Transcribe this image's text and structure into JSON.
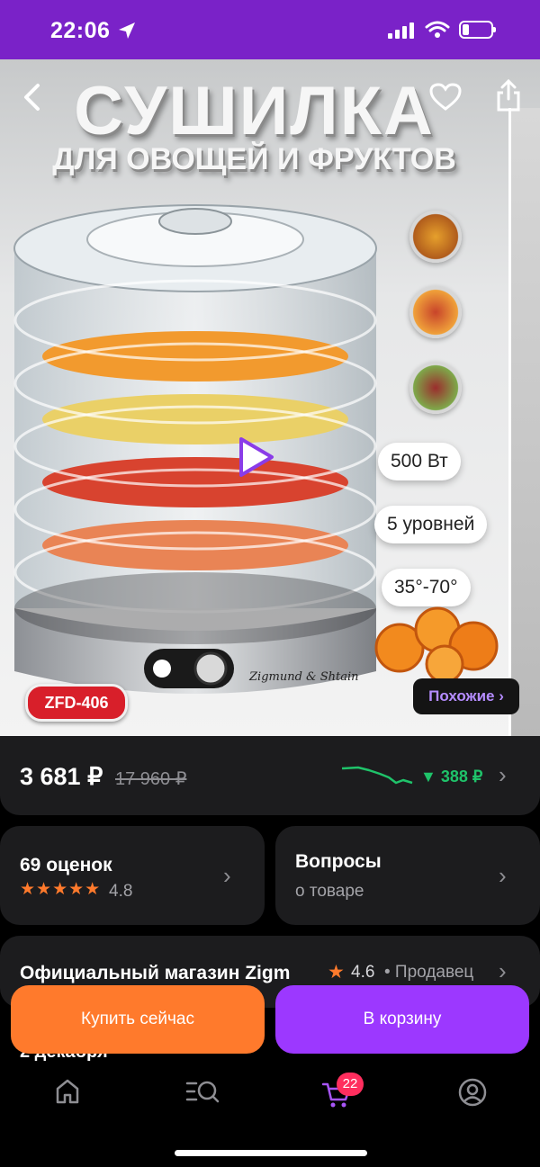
{
  "status_bar": {
    "time": "22:06"
  },
  "product": {
    "image_title": "СУШИЛКА",
    "image_subtitle": "ДЛЯ ОВОЩЕЙ И ФРУКТОВ",
    "brand_on_device": "Zigmund & Shtain",
    "model_badge": "ZFD-406",
    "feature_chips": [
      "500 Вт",
      "5 уровней",
      "35°-70°"
    ],
    "similar_label": "Похожие ›"
  },
  "price": {
    "current": "3 681 ₽",
    "old": "17 960 ₽",
    "drop": "▼ 388 ₽"
  },
  "reviews": {
    "count_label": "69 оценок",
    "stars": "★★★★★",
    "rating": "4.8"
  },
  "questions": {
    "title": "Вопросы",
    "subtitle": "о товаре"
  },
  "seller": {
    "name": "Официальный магазин Zigm",
    "rating": "4.6",
    "suffix": "• Продавец"
  },
  "delivery_peek": "2 декабря",
  "actions": {
    "buy_now": "Купить сейчас",
    "add_to_cart": "В корзину"
  },
  "tabbar": {
    "cart_badge": "22"
  },
  "colors": {
    "brand": "#7a22c8",
    "buy": "#ff7a2c",
    "cart": "#9c38ff",
    "price_drop": "#1fc36a",
    "star": "#ff7a2c"
  }
}
